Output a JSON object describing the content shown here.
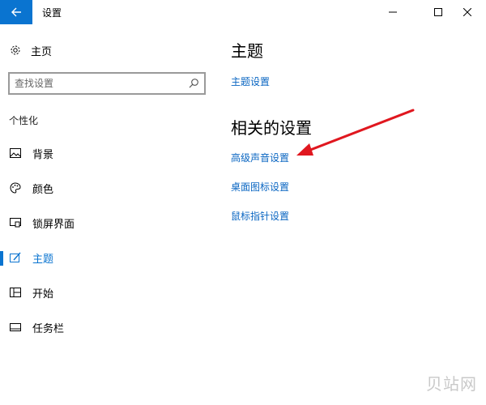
{
  "window": {
    "title": "设置",
    "accent": "#0a74d0",
    "link_color": "#0a66c2"
  },
  "sidebar": {
    "home_label": "主页",
    "search_placeholder": "查找设置",
    "section_label": "个性化",
    "items": [
      {
        "label": "背景",
        "icon": "picture-icon",
        "active": false
      },
      {
        "label": "颜色",
        "icon": "palette-icon",
        "active": false
      },
      {
        "label": "锁屏界面",
        "icon": "lock-screen-icon",
        "active": false
      },
      {
        "label": "主题",
        "icon": "theme-brush-icon",
        "active": true
      },
      {
        "label": "开始",
        "icon": "start-grid-icon",
        "active": false
      },
      {
        "label": "任务栏",
        "icon": "taskbar-icon",
        "active": false
      }
    ]
  },
  "main": {
    "theme_heading": "主题",
    "theme_settings_link": "主题设置",
    "related_heading": "相关的设置",
    "related_links": [
      "高级声音设置",
      "桌面图标设置",
      "鼠标指针设置"
    ]
  },
  "annotation": {
    "arrow_color": "#e0171f"
  },
  "watermark": "贝站网"
}
